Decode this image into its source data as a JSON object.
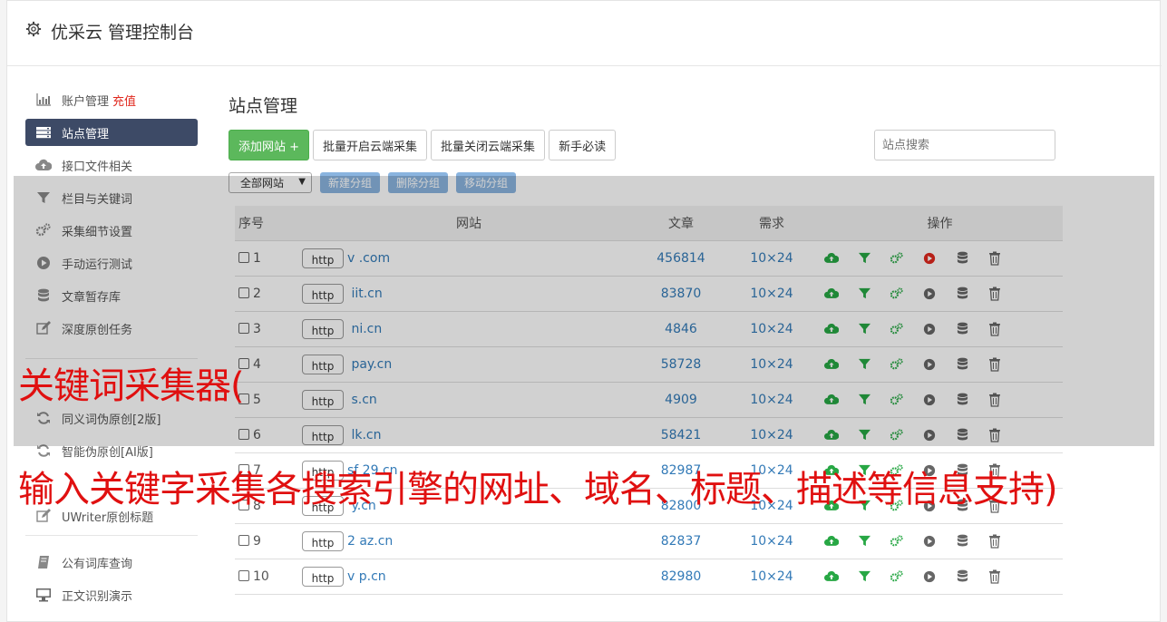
{
  "header": {
    "title": "优采云 管理控制台"
  },
  "sidebar": {
    "items": [
      {
        "label": "账户管理",
        "extra": "充值",
        "icon": "bar-chart-icon"
      },
      {
        "label": "站点管理",
        "icon": "server-icon",
        "active": true
      },
      {
        "label": "接口文件相关",
        "icon": "cloud-upload-icon"
      },
      {
        "label": "栏目与关键词",
        "icon": "filter-icon"
      },
      {
        "label": "采集细节设置",
        "icon": "gears-icon"
      },
      {
        "label": "手动运行测试",
        "icon": "play-icon"
      },
      {
        "label": "文章暂存库",
        "icon": "database-icon"
      },
      {
        "label": "深度原创任务",
        "icon": "edit-icon"
      }
    ],
    "items2": [
      {
        "label": "同义词伪原创[2版]",
        "icon": "refresh-icon"
      },
      {
        "label": "智能伪原创[AI版]",
        "icon": "refresh-icon"
      },
      {
        "label": "UWriter原创标题",
        "icon": "edit-icon"
      }
    ],
    "items3": [
      {
        "label": "公有词库查询",
        "icon": "book-icon"
      },
      {
        "label": "正文识别演示",
        "icon": "monitor-icon"
      }
    ]
  },
  "main": {
    "title": "站点管理",
    "add_label": "添加网站 +",
    "batch_open": "批量开启云端采集",
    "batch_close": "批量关闭云端采集",
    "newbie": "新手必读",
    "search_placeholder": "站点搜索",
    "group_select": "全部网站",
    "new_group": "新建分组",
    "delete_group": "删除分组",
    "move_group": "移动分组"
  },
  "table": {
    "headers": {
      "no": "序号",
      "site": "网站",
      "articles": "文章",
      "need": "需求",
      "ops": "操作"
    },
    "rows": [
      {
        "no": "1",
        "protocol": "http",
        "domain": "v          .com",
        "articles": "456814",
        "need": "10×24",
        "play_active": true
      },
      {
        "no": "2",
        "protocol": "http",
        "domain": "      iit.cn",
        "articles": "83870",
        "need": "10×24"
      },
      {
        "no": "3",
        "protocol": "http",
        "domain": "      ni.cn",
        "articles": "4846",
        "need": "10×24"
      },
      {
        "no": "4",
        "protocol": "http",
        "domain": "      pay.cn",
        "articles": "58728",
        "need": "10×24"
      },
      {
        "no": "5",
        "protocol": "http",
        "domain": "      s.cn",
        "articles": "4909",
        "need": "10×24"
      },
      {
        "no": "6",
        "protocol": "http",
        "domain": "      lk.cn",
        "articles": "58421",
        "need": "10×24"
      },
      {
        "no": "7",
        "protocol": "http",
        "domain": "sf   29.cn",
        "articles": "82987",
        "need": "10×24"
      },
      {
        "no": "8",
        "protocol": "http",
        "domain": "      y.cn",
        "articles": "82800",
        "need": "10×24"
      },
      {
        "no": "9",
        "protocol": "http",
        "domain": "2     az.cn",
        "articles": "82837",
        "need": "10×24"
      },
      {
        "no": "10",
        "protocol": "http",
        "domain": "v     p.cn",
        "articles": "82980",
        "need": "10×24"
      }
    ]
  },
  "captions": {
    "line1": "关键词采集器(",
    "line2": "输入关键字采集各搜索引擎的网址、域名、标题、描述等信息支持)"
  },
  "colors": {
    "green": "#27a744",
    "red": "#e0281e",
    "link": "#337ab7",
    "active_nav": "#3d4a66"
  }
}
